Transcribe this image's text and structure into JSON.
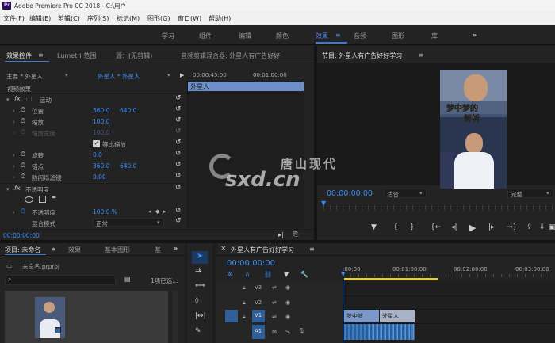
{
  "titlebar": {
    "logo": "Pr",
    "title": "Adobe Premiere Pro CC 2018 - C:\\用户"
  },
  "menu": [
    "文件(F)",
    "编辑(E)",
    "剪辑(C)",
    "序列(S)",
    "标记(M)",
    "图形(G)",
    "窗口(W)",
    "帮助(H)"
  ],
  "workspaces": {
    "tabs": [
      "学习",
      "组件",
      "编辑",
      "颜色",
      "效果",
      "音频",
      "图形",
      "库"
    ],
    "active": "效果",
    "more": "»"
  },
  "effect_controls": {
    "tabs": [
      "效果控件",
      "Lumetri 范围",
      "源：(无剪辑)",
      "音频剪辑混合器: 外星人有广告好好"
    ],
    "master": "主要 * 外星人",
    "clip": "外星人 * 外星人",
    "timecodes": [
      "00:00:45:00",
      "00:01:00:00"
    ],
    "clip_block": "外星人",
    "video_effects": "视频效果",
    "motion": "运动",
    "position": {
      "label": "位置",
      "x": "360.0",
      "y": "640.0"
    },
    "scale": {
      "label": "缩放",
      "value": "100.0"
    },
    "scale_width": {
      "label": "缩放宽度",
      "value": "100.0"
    },
    "uniform_scale": "等比缩放",
    "rotation": {
      "label": "旋转",
      "value": "0.0"
    },
    "anchor": {
      "label": "锚点",
      "x": "360.0",
      "y": "640.0"
    },
    "antiflicker": {
      "label": "防闪烁滤镜",
      "value": "0.00"
    },
    "opacity_section": "不透明度",
    "opacity": {
      "label": "不透明度",
      "value": "100.0 %"
    },
    "blend": {
      "label": "混合模式",
      "value": "正常"
    },
    "timecode": "00:00:00:00"
  },
  "program_monitor": {
    "title": "节目: 外星人有广告好好学习",
    "video_caption": [
      "梦中梦的",
      "解析"
    ],
    "timecode": "00:00:00:00",
    "fit": "适合",
    "quality": "完整"
  },
  "watermark": {
    "brand": "唐山现代",
    "domain": "sxd.cn"
  },
  "project": {
    "tabs": [
      "项目: 未命名",
      "效果",
      "基本图形",
      "基"
    ],
    "file": "未命名.prproj",
    "count": "1项已选..."
  },
  "timeline": {
    "title": "外星人有广告好好学习",
    "timecode": "00:00:00:00",
    "ruler": [
      ":00:00",
      "00:01:00:00",
      "00:02:00:00",
      "00:03:00:00"
    ],
    "tracks": [
      "V3",
      "V2",
      "V1",
      "A1"
    ],
    "clip_labels": [
      "梦中梦",
      "外星人"
    ],
    "track_flags": [
      "M",
      "S"
    ]
  }
}
